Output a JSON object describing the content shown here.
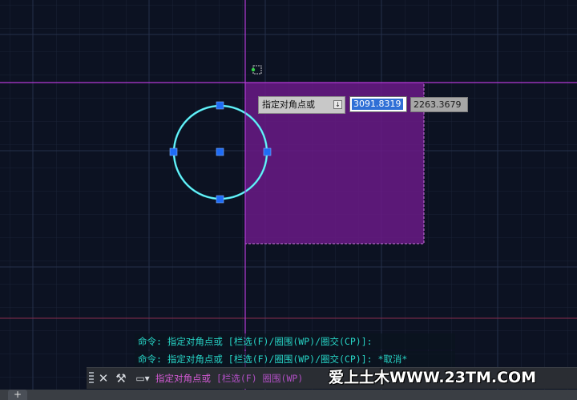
{
  "dynamic_input": {
    "prompt": "指定对角点或",
    "x_value": "3091.8319",
    "y_value": "2263.3679"
  },
  "command_history": [
    "命令: 指定对角点或 [栏选(F)/圈围(WP)/圈交(CP)]:",
    "命令: 指定对角点或 [栏选(F)/圈围(WP)/圈交(CP)]: *取消*"
  ],
  "command_line": {
    "prompt": "指定对角点或",
    "options": "[栏选(F) 圈围(WP)"
  },
  "watermark": "爱上土木WWW.23TM.COM",
  "colors": {
    "background": "#0c1222",
    "crosshair": "#b23ad6",
    "selection_fill": "#6a1a86",
    "circle": "#44e6ef",
    "grip": "#1f6cf5",
    "command_text": "#27d3c5"
  }
}
